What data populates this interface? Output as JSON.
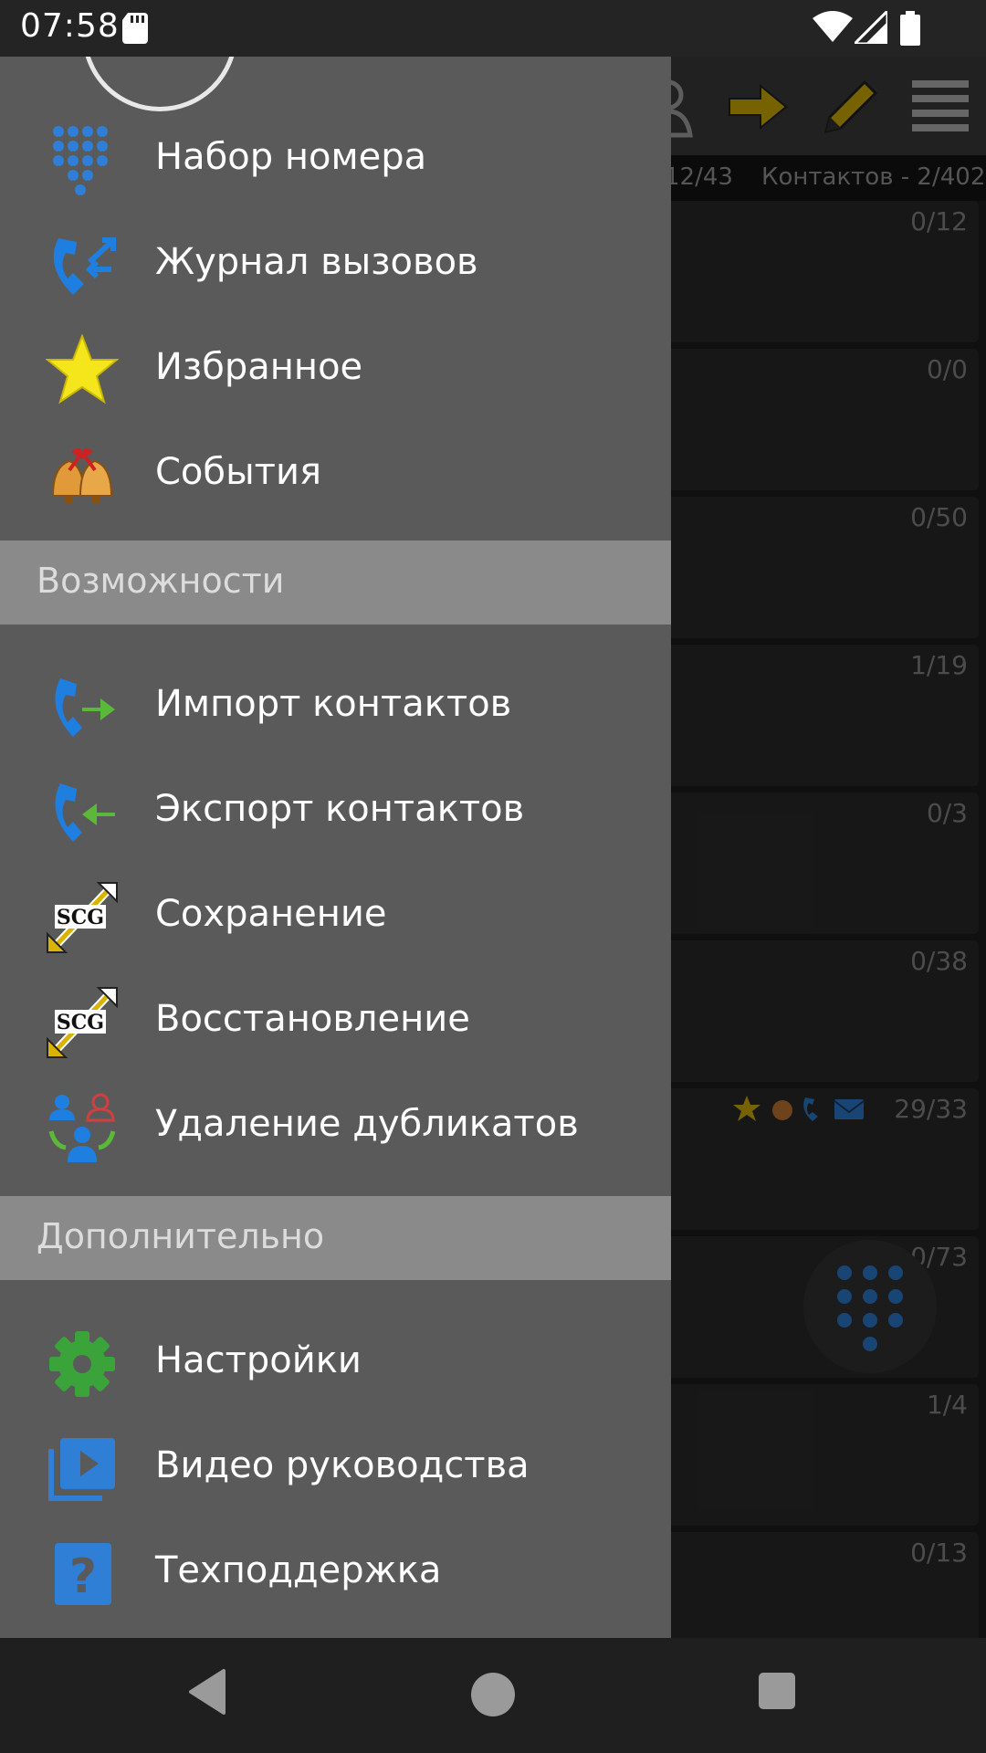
{
  "status_bar": {
    "time": "07:58",
    "icons": [
      "sd-card-icon",
      "wifi-icon",
      "signal-icon",
      "battery-icon"
    ]
  },
  "app": {
    "toolbar_icons": [
      "contacts-icon",
      "arrow-right-icon",
      "pencil-icon",
      "menu-icon"
    ],
    "tabs": {
      "groups": "12/43",
      "contacts": "Контактов - 2/402"
    },
    "group_counts": [
      "0/12",
      "0/0",
      "0/50",
      "1/19",
      "0/3",
      "0/38",
      "29/33",
      "0/73",
      "1/4",
      "0/13"
    ],
    "fab_icon": "dialpad-icon"
  },
  "drawer": {
    "main_items": [
      {
        "label": "Набор номера",
        "icon": "dialpad-icon"
      },
      {
        "label": "Журнал вызовов",
        "icon": "call-log-icon"
      },
      {
        "label": "Избранное",
        "icon": "star-icon"
      },
      {
        "label": "События",
        "icon": "bells-icon"
      }
    ],
    "section_features": "Возможности",
    "feature_items": [
      {
        "label": "Импорт контактов",
        "icon": "import-icon"
      },
      {
        "label": "Экспорт контактов",
        "icon": "export-icon"
      },
      {
        "label": "Сохранение",
        "icon": "backup-icon"
      },
      {
        "label": "Восстановление",
        "icon": "restore-icon"
      },
      {
        "label": "Удаление дубликатов",
        "icon": "merge-duplicates-icon"
      }
    ],
    "section_extra": "Дополнительно",
    "extra_items": [
      {
        "label": "Настройки",
        "icon": "gear-icon"
      },
      {
        "label": "Видео руководства",
        "icon": "video-icon"
      },
      {
        "label": "Техподдержка",
        "icon": "help-icon"
      }
    ]
  },
  "colors": {
    "drawer_bg": "#5a5a5a",
    "section_bg": "#8a8a8a",
    "accent_blue": "#2f7fd6",
    "star_yellow": "#f5e51b",
    "gear_green": "#3aa33a"
  }
}
